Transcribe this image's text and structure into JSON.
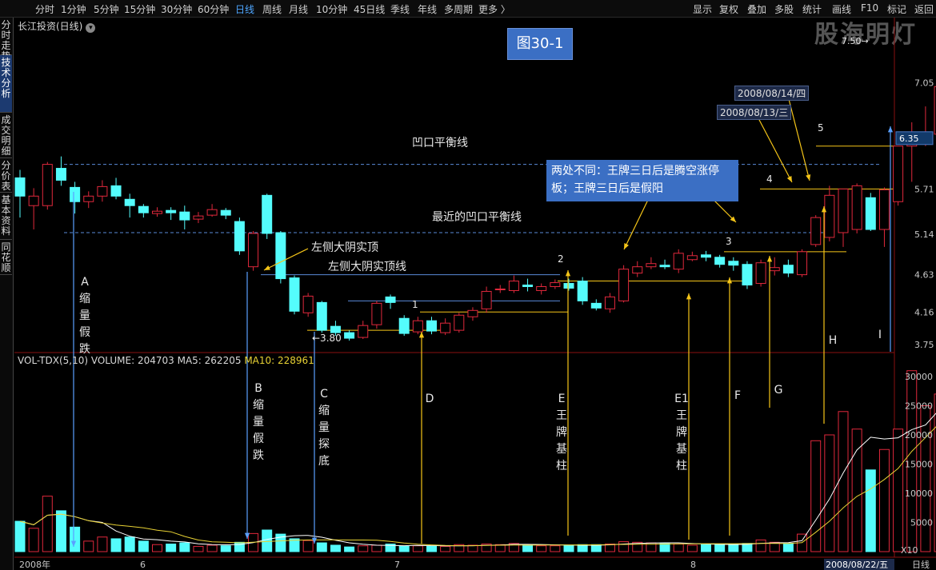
{
  "toolbar": {
    "periods": [
      "分时",
      "1分钟",
      "5分钟",
      "15分钟",
      "30分钟",
      "60分钟",
      "日线",
      "周线",
      "月线",
      "10分钟",
      "45日线",
      "季线",
      "年线",
      "多周期",
      "更多  〉"
    ],
    "active_period": "日线",
    "right_buttons": [
      "显示",
      "复权",
      "叠加",
      "多股",
      "统计",
      "画线",
      "F10",
      "标记",
      "返回"
    ]
  },
  "sidebar": {
    "tabs": [
      "分时走势",
      "技术分析",
      "成交明细",
      "分价表",
      "基本资料",
      "同花顺"
    ],
    "active_tab": "技术分析"
  },
  "stock_title": "长江投资(日线)",
  "watermark": "股海明灯",
  "figure_label": "图30-1",
  "note_box": "两处不同：王牌三日后是腾空涨停板；王牌三日后是假阳",
  "date_labels": {
    "d1": "2008/08/13/三",
    "d2": "2008/08/14/四",
    "bottom_date": "2008/08/22/五"
  },
  "volume_legend": {
    "indicator": "VOL-TDX(5,10)",
    "volume": "VOLUME: 204703",
    "ma5": "MA5: 262205",
    "ma10": "MA10: 228961"
  },
  "annotations": {
    "hline1": "凹口平衡线",
    "hline2": "最近的凹口平衡线",
    "left_top": "左侧大阴实顶",
    "left_top_line": "左侧大阴实顶线",
    "low_marker": "←3.80",
    "high_marker": "7.50→",
    "last_price": "6.35",
    "numbers": [
      "1",
      "2",
      "3",
      "4",
      "5"
    ],
    "A": [
      "A",
      "缩",
      "量",
      "假",
      "跌"
    ],
    "B": [
      "B",
      "缩",
      "量",
      "假",
      "跌"
    ],
    "C": [
      "C",
      "缩",
      "量",
      "探",
      "底"
    ],
    "D": "D",
    "E": [
      "E",
      "王",
      "牌",
      "基",
      "柱"
    ],
    "E1": [
      "E1",
      "王",
      "牌",
      "基",
      "柱"
    ],
    "F": "F",
    "G": "G",
    "H": "H",
    "I": "I"
  },
  "x_axis": {
    "labels": [
      "2008年",
      "6",
      "7",
      "8",
      "日线"
    ]
  },
  "colors": {
    "up": "#e0283c",
    "down": "#54fcfc",
    "ma5": "#ffffff",
    "ma10": "#e8d234",
    "arrow_yellow": "#f5c518",
    "arrow_blue": "#5aa0ff",
    "hline": "#5a8ad8"
  },
  "chart_data": {
    "type": "candlestick",
    "price_axis": {
      "ticks": [
        3.75,
        4.16,
        4.63,
        5.14,
        5.71,
        6.35,
        7.05
      ],
      "tick_labels": [
        "3.75",
        "4.16",
        "4.63",
        "5.14",
        "5.71",
        "6.35",
        "7.05"
      ]
    },
    "volume_axis": {
      "ticks": [
        5000,
        10000,
        15000,
        20000,
        25000,
        30000
      ],
      "tick_labels": [
        "5000",
        "10000",
        "15000",
        "20000",
        "25000",
        "30000"
      ],
      "unit": "X10"
    },
    "candles": [
      {
        "o": 5.85,
        "c": 5.62,
        "h": 5.95,
        "l": 5.35,
        "v": 5200
      },
      {
        "o": 5.5,
        "c": 5.62,
        "h": 5.72,
        "l": 5.2,
        "v": 4000
      },
      {
        "o": 5.5,
        "c": 6.02,
        "h": 6.05,
        "l": 5.45,
        "v": 9500
      },
      {
        "o": 5.97,
        "c": 5.82,
        "h": 6.12,
        "l": 5.75,
        "v": 7000
      },
      {
        "o": 5.73,
        "c": 5.55,
        "h": 5.8,
        "l": 5.4,
        "v": 4200
      },
      {
        "o": 5.55,
        "c": 5.62,
        "h": 5.68,
        "l": 5.47,
        "v": 1800
      },
      {
        "o": 5.62,
        "c": 5.74,
        "h": 5.82,
        "l": 5.55,
        "v": 2500
      },
      {
        "o": 5.75,
        "c": 5.62,
        "h": 5.85,
        "l": 5.58,
        "v": 2200
      },
      {
        "o": 5.58,
        "c": 5.5,
        "h": 5.65,
        "l": 5.35,
        "v": 2500
      },
      {
        "o": 5.49,
        "c": 5.41,
        "h": 5.52,
        "l": 5.35,
        "v": 1800
      },
      {
        "o": 5.4,
        "c": 5.43,
        "h": 5.48,
        "l": 5.36,
        "v": 1200
      },
      {
        "o": 5.44,
        "c": 5.41,
        "h": 5.48,
        "l": 5.32,
        "v": 1300
      },
      {
        "o": 5.42,
        "c": 5.32,
        "h": 5.5,
        "l": 5.2,
        "v": 1500
      },
      {
        "o": 5.33,
        "c": 5.37,
        "h": 5.42,
        "l": 5.28,
        "v": 900
      },
      {
        "o": 5.38,
        "c": 5.45,
        "h": 5.52,
        "l": 5.36,
        "v": 1100
      },
      {
        "o": 5.44,
        "c": 5.38,
        "h": 5.47,
        "l": 5.33,
        "v": 1000
      },
      {
        "o": 5.3,
        "c": 4.93,
        "h": 5.35,
        "l": 4.88,
        "v": 1600
      },
      {
        "o": 4.73,
        "c": 5.15,
        "h": 5.18,
        "l": 4.68,
        "v": 3100
      },
      {
        "o": 5.63,
        "c": 5.15,
        "h": 5.65,
        "l": 5.08,
        "v": 3700
      },
      {
        "o": 5.16,
        "c": 4.58,
        "h": 5.18,
        "l": 4.52,
        "v": 3000
      },
      {
        "o": 4.59,
        "c": 4.17,
        "h": 4.62,
        "l": 4.13,
        "v": 2200
      },
      {
        "o": 4.15,
        "c": 4.36,
        "h": 4.4,
        "l": 4.1,
        "v": 1900
      },
      {
        "o": 4.28,
        "c": 3.93,
        "h": 4.3,
        "l": 3.9,
        "v": 1500
      },
      {
        "o": 3.98,
        "c": 3.9,
        "h": 4.05,
        "l": 3.86,
        "v": 1100
      },
      {
        "o": 3.9,
        "c": 3.83,
        "h": 3.93,
        "l": 3.8,
        "v": 800
      },
      {
        "o": 3.84,
        "c": 3.99,
        "h": 4.05,
        "l": 3.82,
        "v": 1000
      },
      {
        "o": 4.0,
        "c": 4.27,
        "h": 4.3,
        "l": 3.95,
        "v": 1100
      },
      {
        "o": 4.35,
        "c": 4.28,
        "h": 4.38,
        "l": 4.2,
        "v": 1300
      },
      {
        "o": 4.08,
        "c": 3.89,
        "h": 4.12,
        "l": 3.86,
        "v": 900
      },
      {
        "o": 3.91,
        "c": 4.05,
        "h": 4.1,
        "l": 3.88,
        "v": 1000
      },
      {
        "o": 4.05,
        "c": 3.92,
        "h": 4.1,
        "l": 3.88,
        "v": 900
      },
      {
        "o": 3.9,
        "c": 4.02,
        "h": 4.08,
        "l": 3.87,
        "v": 900
      },
      {
        "o": 3.93,
        "c": 4.12,
        "h": 4.15,
        "l": 3.9,
        "v": 1200
      },
      {
        "o": 4.1,
        "c": 4.18,
        "h": 4.22,
        "l": 4.05,
        "v": 1100
      },
      {
        "o": 4.2,
        "c": 4.42,
        "h": 4.48,
        "l": 4.15,
        "v": 1300
      },
      {
        "o": 4.45,
        "c": 4.45,
        "h": 4.5,
        "l": 4.4,
        "v": 1200
      },
      {
        "o": 4.43,
        "c": 4.55,
        "h": 4.62,
        "l": 4.4,
        "v": 1400
      },
      {
        "o": 4.5,
        "c": 4.48,
        "h": 4.58,
        "l": 4.42,
        "v": 1200
      },
      {
        "o": 4.43,
        "c": 4.48,
        "h": 4.52,
        "l": 4.38,
        "v": 1000
      },
      {
        "o": 4.48,
        "c": 4.53,
        "h": 4.57,
        "l": 4.45,
        "v": 1000
      },
      {
        "o": 4.52,
        "c": 4.46,
        "h": 4.58,
        "l": 4.43,
        "v": 1100
      },
      {
        "o": 4.55,
        "c": 4.3,
        "h": 4.6,
        "l": 4.25,
        "v": 1200
      },
      {
        "o": 4.27,
        "c": 4.21,
        "h": 4.32,
        "l": 4.18,
        "v": 1200
      },
      {
        "o": 4.2,
        "c": 4.35,
        "h": 4.4,
        "l": 4.15,
        "v": 1300
      },
      {
        "o": 4.3,
        "c": 4.7,
        "h": 4.75,
        "l": 4.28,
        "v": 1700
      },
      {
        "o": 4.65,
        "c": 4.73,
        "h": 4.8,
        "l": 4.6,
        "v": 1600
      },
      {
        "o": 4.73,
        "c": 4.77,
        "h": 4.85,
        "l": 4.7,
        "v": 1500
      },
      {
        "o": 4.75,
        "c": 4.73,
        "h": 4.82,
        "l": 4.7,
        "v": 1400
      },
      {
        "o": 4.7,
        "c": 4.9,
        "h": 4.95,
        "l": 4.65,
        "v": 1300
      },
      {
        "o": 4.82,
        "c": 4.87,
        "h": 4.92,
        "l": 4.8,
        "v": 1100
      },
      {
        "o": 4.88,
        "c": 4.85,
        "h": 4.93,
        "l": 4.8,
        "v": 1200
      },
      {
        "o": 4.85,
        "c": 4.76,
        "h": 4.88,
        "l": 4.72,
        "v": 1200
      },
      {
        "o": 4.8,
        "c": 4.75,
        "h": 4.85,
        "l": 4.68,
        "v": 1300
      },
      {
        "o": 4.76,
        "c": 4.5,
        "h": 4.8,
        "l": 4.45,
        "v": 1400
      },
      {
        "o": 4.52,
        "c": 4.78,
        "h": 4.82,
        "l": 4.48,
        "v": 2000
      },
      {
        "o": 4.68,
        "c": 4.72,
        "h": 4.85,
        "l": 4.62,
        "v": 1600
      },
      {
        "o": 4.75,
        "c": 4.65,
        "h": 4.82,
        "l": 4.6,
        "v": 1400
      },
      {
        "o": 4.63,
        "c": 4.92,
        "h": 4.95,
        "l": 4.6,
        "v": 3000
      },
      {
        "o": 5.01,
        "c": 5.35,
        "h": 5.38,
        "l": 4.98,
        "v": 19000
      },
      {
        "o": 5.1,
        "c": 5.63,
        "h": 5.75,
        "l": 5.05,
        "v": 20000
      },
      {
        "o": 5.16,
        "c": 5.71,
        "h": 5.71,
        "l": 4.98,
        "v": 24000
      },
      {
        "o": 5.2,
        "c": 5.75,
        "h": 5.78,
        "l": 5.15,
        "v": 21000
      },
      {
        "o": 5.6,
        "c": 5.2,
        "h": 5.66,
        "l": 5.18,
        "v": 14000
      },
      {
        "o": 5.2,
        "c": 5.7,
        "h": 5.73,
        "l": 4.98,
        "v": 17500
      },
      {
        "o": 5.55,
        "c": 6.25,
        "h": 6.25,
        "l": 5.5,
        "v": 21000
      },
      {
        "o": 6.25,
        "c": 6.3,
        "h": 6.55,
        "l": 5.8,
        "v": 31000
      },
      {
        "o": 6.35,
        "c": 6.35,
        "h": 6.75,
        "l": 6.25,
        "v": 25000
      },
      {
        "o": 6.4,
        "c": 7.0,
        "h": 7.2,
        "l": 6.3,
        "v": 27000
      },
      {
        "o": 6.7,
        "c": 7.05,
        "h": 7.5,
        "l": 6.45,
        "v": 29000
      },
      {
        "o": 6.8,
        "c": 6.35,
        "h": 6.85,
        "l": 6.3,
        "v": 20470
      }
    ],
    "horizontal_lines": [
      {
        "name": "凹口平衡线",
        "value": 6.02
      },
      {
        "name": "最近的凹口平衡线",
        "value": 5.16
      },
      {
        "name": "左侧大阴实顶线",
        "value": 4.63
      }
    ]
  }
}
